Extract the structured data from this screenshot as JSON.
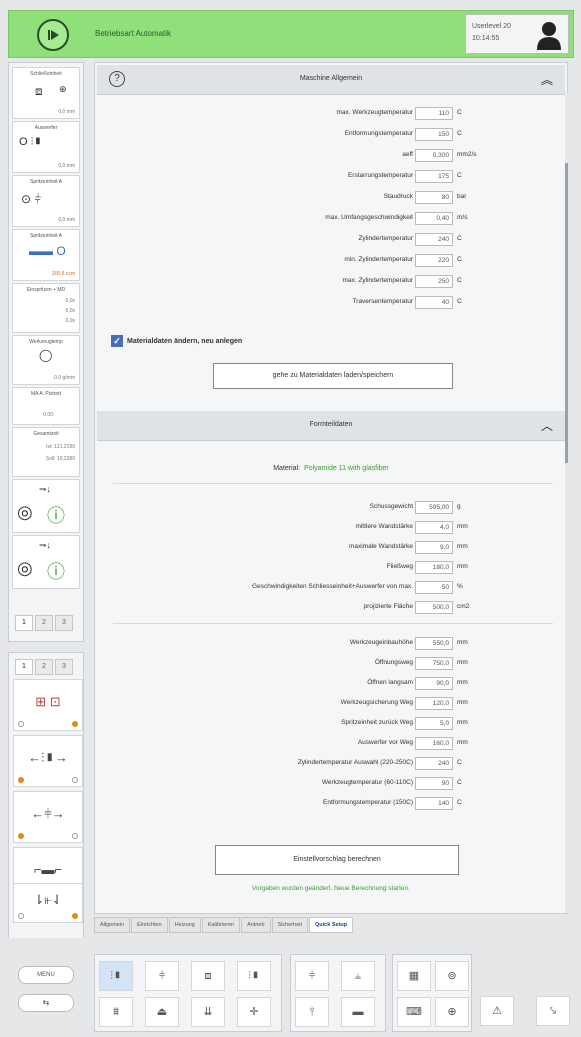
{
  "header": {
    "title": "Betriebsart Automatik",
    "userlevel": "Userlevel 20",
    "time": "10:14:55"
  },
  "sidebar": {
    "boxes": [
      {
        "title": "Schließeinheit",
        "value": "0,0 mm"
      },
      {
        "title": "Auswerfer",
        "value": "0,0 mm"
      },
      {
        "title": "Spritzeinheit A",
        "value": "0,0 mm"
      },
      {
        "title": "Spritzeinheit A",
        "value": "200,6 ccm"
      },
      {
        "title": "Einspritzen + MD",
        "lines": [
          "0,0s",
          "0,0s",
          "0,0s"
        ]
      },
      {
        "title": "Werkzeugtemp",
        "value": "0,0 g/mm"
      },
      {
        "title": "MA A: Pistrett",
        "value": "0,00"
      },
      {
        "title": "Gesamtzeit",
        "lines": [
          "Ist: 121,2190",
          "Soll: 10,2280"
        ]
      }
    ],
    "pages": [
      "1",
      "2",
      "3"
    ],
    "tool_pages": [
      "1",
      "2",
      "3"
    ]
  },
  "main": {
    "section1_title": "Maschine Allgemein",
    "section1_fields": [
      {
        "label": "max. Werkzeugtemperatur",
        "value": "110",
        "unit": "C"
      },
      {
        "label": "Entformungstemperatur",
        "value": "150",
        "unit": "C"
      },
      {
        "label": "aeff",
        "value": "0,300",
        "unit": "mm2/s"
      },
      {
        "label": "Erstarrungstemperatur",
        "value": "175",
        "unit": "C"
      },
      {
        "label": "Staudruck",
        "value": "80",
        "unit": "bar"
      },
      {
        "label": "max. Umfangsgeschwindigkeit",
        "value": "0,40",
        "unit": "m/s"
      },
      {
        "label": "Zylindertemperatur",
        "value": "240",
        "unit": "C"
      },
      {
        "label": "min. Zylindertemperatur",
        "value": "220",
        "unit": "C"
      },
      {
        "label": "max. Zylindertemperatur",
        "value": "250",
        "unit": "C"
      },
      {
        "label": "Traversentemperatur",
        "value": "40",
        "unit": "C"
      }
    ],
    "checkbox_label": "Materialdaten ändern, neu anlegen",
    "goto_button": "gehe zu Materialdaten laden/speichern",
    "section2_title": "Formteildaten",
    "material_label": "Material:",
    "material_value": "Polyamide 11 with glasfiber",
    "section2_fields_a": [
      {
        "label": "Schussgewicht",
        "value": "595,00",
        "unit": "g"
      },
      {
        "label": "mittlere Wandstärke",
        "value": "4,0",
        "unit": "mm"
      },
      {
        "label": "maximale Wandstärke",
        "value": "9,0",
        "unit": "mm"
      },
      {
        "label": "Fließweg",
        "value": "180,0",
        "unit": "mm"
      },
      {
        "label": "Geschwindigkeiten Schliesseinheit+Auswerfer von max.",
        "value": "50",
        "unit": "%"
      },
      {
        "label": "projizierte Fläche",
        "value": "500,0",
        "unit": "cm2"
      }
    ],
    "section2_fields_b": [
      {
        "label": "Werkzeugeinbauhöhe",
        "value": "550,0",
        "unit": "mm"
      },
      {
        "label": "Öffnungsweg",
        "value": "750,0",
        "unit": "mm"
      },
      {
        "label": "Öffnen langsam",
        "value": "90,0",
        "unit": "mm"
      },
      {
        "label": "Werkzeugsicherung Weg",
        "value": "120,0",
        "unit": "mm"
      },
      {
        "label": "Spritzeinheit zurück Weg",
        "value": "5,0",
        "unit": "mm"
      },
      {
        "label": "Auswerfer vor Weg",
        "value": "160,0",
        "unit": "mm"
      },
      {
        "label": "Zylindertemperatur Auswahl (220-250C)",
        "value": "240",
        "unit": "C"
      },
      {
        "label": "Werkzeugtemperatur (60-110C)",
        "value": "90",
        "unit": "C"
      },
      {
        "label": "Entformungstemperatur (150C)",
        "value": "140",
        "unit": "C"
      }
    ],
    "calc_button": "Einstellvorschlag berechnen",
    "hint": "Vorgaben wurden geändert. Neue Berechnung starten."
  },
  "tabs": [
    "Allgemein",
    "Einrichten",
    "Heizung",
    "Kalibrieren",
    "Antrieb",
    "Sicherheit",
    "Quick Setup"
  ],
  "bottom": {
    "menu_label": "MENU",
    "nav_label": "⇆"
  },
  "colors": {
    "header_green": "#8fe07a",
    "accent_blue": "#4a6fb3",
    "hint_green": "#3a9d2e",
    "orange": "#e08a1a"
  }
}
